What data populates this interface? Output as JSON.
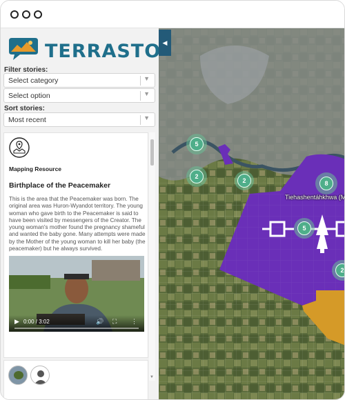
{
  "window": {
    "controls": [
      "close",
      "minimize",
      "maximize"
    ]
  },
  "app": {
    "name": "TERRASTORIES",
    "logo_icon": "speech-bubble-landscape-icon"
  },
  "filters": {
    "label": "Filter stories:",
    "category_placeholder": "Select category",
    "option_placeholder": "Select option"
  },
  "sort": {
    "label": "Sort stories:",
    "selected": "Most recent"
  },
  "story": {
    "icon": "map-pin-icon",
    "type": "Mapping Resource",
    "title": "Birthplace of the Peacemaker",
    "description": "This is the area that the Peacemaker was born. The original area was Huron-Wyandot territory. The young woman who gave birth to the Peacemaker is said to have been visited by messengers of the Creator. The young woman's mother found the pregnancy shameful and wanted the baby gone. Many attempts were made by the Mother of the young woman to kill her baby (the peacemaker) but he always survived.",
    "video": {
      "time": "0:00 / 3:02",
      "progress": 0
    }
  },
  "map": {
    "collapse_icon": "chevron-left-icon",
    "clusters": [
      {
        "count": "5"
      },
      {
        "count": "2"
      },
      {
        "count": "2"
      },
      {
        "count": "8"
      },
      {
        "count": "5"
      },
      {
        "count": "2"
      }
    ],
    "territory_label": "Tiehashentáhkhwa (M",
    "colors": {
      "territory_purple": "#6a2fb8",
      "territory_orange": "#d59a28",
      "cluster": "#4fae8a"
    }
  }
}
